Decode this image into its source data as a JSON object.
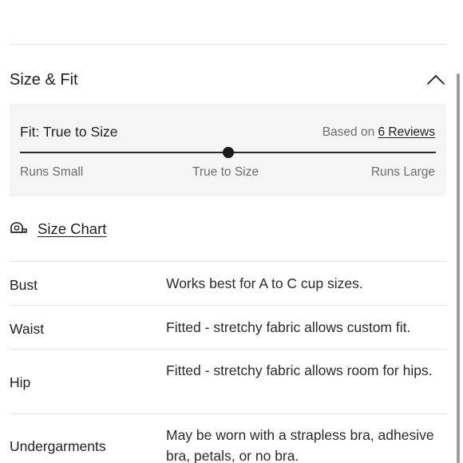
{
  "section": {
    "title": "Size & Fit",
    "collapse_icon": "chevron-up-icon"
  },
  "fit": {
    "label": "Fit: True to Size",
    "reviews_prefix": "Based on ",
    "reviews_link": "6 Reviews",
    "scale_left": "Runs Small",
    "scale_middle": "True to Size",
    "scale_right": "Runs Large",
    "fit_position_fraction": 0.5
  },
  "size_chart": {
    "label": "Size Chart",
    "icon": "measuring-tape-icon"
  },
  "fit_details": [
    {
      "name": "Bust",
      "description": "Works best for A to C cup sizes."
    },
    {
      "name": "Waist",
      "description": "Fitted - stretchy fabric allows custom fit."
    },
    {
      "name": "Hip",
      "description": "Fitted - stretchy fabric allows room for hips."
    },
    {
      "name": "Undergarments",
      "description": "May be worn with a strapless bra, adhesive bra, petals, or no bra."
    }
  ]
}
